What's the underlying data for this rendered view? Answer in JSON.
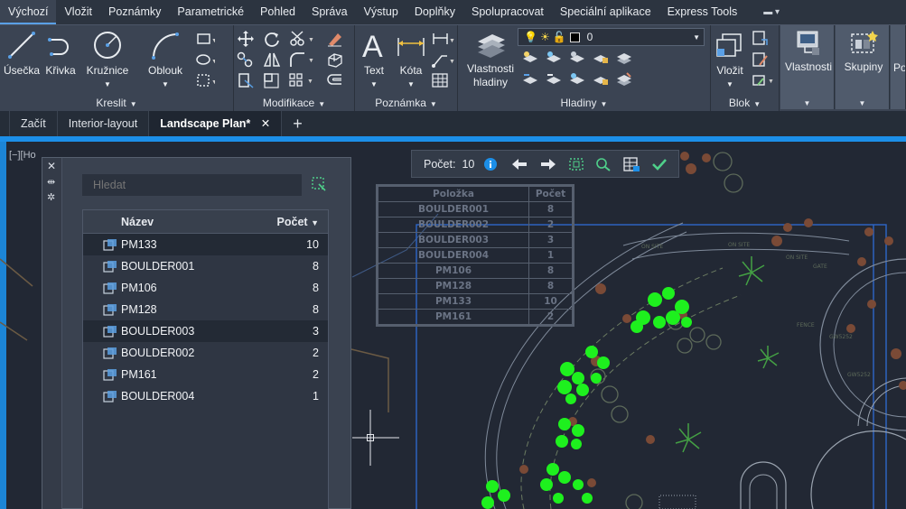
{
  "ribbon_tabs": [
    "Výchozí",
    "Vložit",
    "Poznámky",
    "Parametrické",
    "Pohled",
    "Správa",
    "Výstup",
    "Doplňky",
    "Spolupracovat",
    "Speciální aplikace",
    "Express Tools"
  ],
  "panels": {
    "draw": {
      "title": "Kreslit",
      "line": "Úsečka",
      "polyline": "Křivka",
      "circle": "Kružnice",
      "arc": "Oblouk"
    },
    "modify": {
      "title": "Modifikace"
    },
    "annotation": {
      "title": "Poznámka",
      "text": "Text",
      "dimension": "Kóta"
    },
    "layers": {
      "title": "Hladiny",
      "layer_props_line1": "Vlastnosti",
      "layer_props_line2": "hladiny",
      "current_layer": "0"
    },
    "block": {
      "title": "Blok",
      "insert": "Vložit"
    },
    "properties": {
      "label": "Vlastnosti"
    },
    "groups": {
      "label": "Skupiny"
    },
    "cut": {
      "label": "Po"
    }
  },
  "doc_tabs": [
    "Začít",
    "Interior-layout",
    "Landscape Plan*"
  ],
  "view_label": "[−][Ho",
  "palette": {
    "search_placeholder": "Hledat",
    "col_name": "Název",
    "col_count": "Počet",
    "rows": [
      {
        "name": "PM133",
        "count": "10"
      },
      {
        "name": "BOULDER001",
        "count": "8"
      },
      {
        "name": "PM106",
        "count": "8"
      },
      {
        "name": "PM128",
        "count": "8"
      },
      {
        "name": "BOULDER003",
        "count": "3"
      },
      {
        "name": "BOULDER002",
        "count": "2"
      },
      {
        "name": "PM161",
        "count": "2"
      },
      {
        "name": "BOULDER004",
        "count": "1"
      }
    ]
  },
  "count_bar": {
    "label": "Počet:",
    "value": "10"
  },
  "drawing_table": {
    "header": [
      "Položka",
      "Počet"
    ],
    "rows": [
      [
        "BOULDER001",
        "8"
      ],
      [
        "BOULDER002",
        "2"
      ],
      [
        "BOULDER003",
        "3"
      ],
      [
        "BOULDER004",
        "1"
      ],
      [
        "PM106",
        "8"
      ],
      [
        "PM128",
        "8"
      ],
      [
        "PM133",
        "10"
      ],
      [
        "PM161",
        "2"
      ]
    ]
  },
  "drawing_labels": {
    "on_site_1": "ON SITE",
    "on_site_2": "ON SITE",
    "on_site_3": "ON SITE",
    "gate": "GATE",
    "gw1": "GW5252",
    "gw2": "GW5252",
    "fence": "FENCE"
  },
  "colors": {
    "accent": "#1c8fe8",
    "plant_green": "#1ef01e",
    "shrub_brown": "#7a4a36",
    "canvas_bg": "#222834"
  }
}
